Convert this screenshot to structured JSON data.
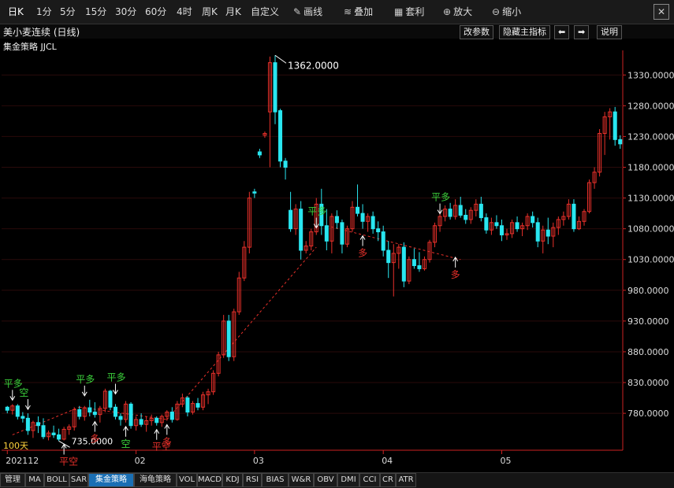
{
  "toolbar": {
    "periods": [
      "日K",
      "1分",
      "5分",
      "15分",
      "30分",
      "60分",
      "4时",
      "周K",
      "月K",
      "自定义"
    ],
    "active": "日K",
    "tools": [
      {
        "icon": "pencil-icon",
        "glyph": "✎",
        "label": "画线"
      },
      {
        "icon": "layers-icon",
        "glyph": "≋",
        "label": "叠加"
      },
      {
        "icon": "arbitrage-icon",
        "glyph": "▦",
        "label": "套利"
      },
      {
        "icon": "zoom-in-icon",
        "glyph": "⊕",
        "label": "放大"
      },
      {
        "icon": "zoom-out-icon",
        "glyph": "⊖",
        "label": "缩小"
      }
    ],
    "close_glyph": "✕"
  },
  "chart_header": {
    "title": "美小麦连续 (日线)",
    "strategy": "集金策略 JJCL",
    "buttons": {
      "modify_params": "改参数",
      "hide_main": "隐藏主指标",
      "prev": "⬅",
      "next": "➡",
      "help": "说明"
    }
  },
  "bottom_tabs": [
    "管理",
    "MA",
    "BOLL",
    "SAR",
    "集金策略",
    "海龟策略",
    "VOL",
    "MACD",
    "KDJ",
    "RSI",
    "BIAS",
    "W&R",
    "OBV",
    "DMI",
    "CCI",
    "CR",
    "ATR"
  ],
  "bottom_active": "集金策略",
  "colors": {
    "up": "#e8302a",
    "down": "#29e6f0",
    "axis": "#cc2222",
    "grid": "#2a0a0a",
    "buy": "#e8302a",
    "sell": "#3cd23c"
  },
  "chart_data": {
    "type": "candlestick",
    "y_ticks": [
      780,
      830,
      880,
      930,
      980,
      1030,
      1080,
      1130,
      1180,
      1230,
      1280,
      1330
    ],
    "ylim": [
      720,
      1370
    ],
    "x_labels": [
      {
        "i": 0,
        "text": "202112"
      },
      {
        "i": 25,
        "text": "02"
      },
      {
        "i": 48,
        "text": "03"
      },
      {
        "i": 73,
        "text": "04"
      },
      {
        "i": 96,
        "text": "05"
      }
    ],
    "count_label": "100天",
    "high_label": {
      "i": 52,
      "text": "1362.0000"
    },
    "low_label": {
      "i": 10,
      "text": "735.0000"
    },
    "candles": [
      [
        790,
        792,
        780,
        785
      ],
      [
        785,
        795,
        778,
        792
      ],
      [
        792,
        795,
        770,
        775
      ],
      [
        775,
        782,
        765,
        772
      ],
      [
        772,
        780,
        745,
        752
      ],
      [
        752,
        768,
        740,
        765
      ],
      [
        765,
        775,
        748,
        760
      ],
      [
        760,
        772,
        738,
        742
      ],
      [
        742,
        752,
        736,
        748
      ],
      [
        748,
        760,
        740,
        745
      ],
      [
        745,
        755,
        735,
        738
      ],
      [
        738,
        758,
        736,
        754
      ],
      [
        754,
        762,
        745,
        758
      ],
      [
        758,
        790,
        752,
        786
      ],
      [
        786,
        792,
        770,
        775
      ],
      [
        775,
        792,
        768,
        789
      ],
      [
        789,
        802,
        775,
        782
      ],
      [
        782,
        798,
        773,
        778
      ],
      [
        778,
        792,
        765,
        788
      ],
      [
        788,
        820,
        782,
        816
      ],
      [
        816,
        818,
        785,
        790
      ],
      [
        790,
        795,
        770,
        775
      ],
      [
        775,
        780,
        760,
        770
      ],
      [
        770,
        800,
        765,
        795
      ],
      [
        795,
        798,
        755,
        760
      ],
      [
        760,
        775,
        752,
        770
      ],
      [
        770,
        780,
        758,
        762
      ],
      [
        762,
        775,
        750,
        768
      ],
      [
        768,
        778,
        760,
        772
      ],
      [
        772,
        775,
        760,
        765
      ],
      [
        765,
        778,
        758,
        775
      ],
      [
        775,
        785,
        768,
        782
      ],
      [
        782,
        790,
        765,
        770
      ],
      [
        770,
        800,
        768,
        795
      ],
      [
        795,
        812,
        790,
        805
      ],
      [
        805,
        808,
        775,
        782
      ],
      [
        782,
        800,
        778,
        796
      ],
      [
        796,
        805,
        785,
        790
      ],
      [
        790,
        815,
        785,
        810
      ],
      [
        810,
        820,
        795,
        815
      ],
      [
        815,
        850,
        810,
        845
      ],
      [
        845,
        880,
        840,
        875
      ],
      [
        875,
        940,
        870,
        930
      ],
      [
        930,
        940,
        865,
        872
      ],
      [
        872,
        950,
        865,
        945
      ],
      [
        945,
        1010,
        940,
        1000
      ],
      [
        1000,
        1060,
        995,
        1050
      ],
      [
        1050,
        1140,
        1040,
        1130
      ],
      [
        1140,
        1145,
        1130,
        1138
      ],
      [
        1205,
        1210,
        1195,
        1200
      ],
      [
        1232,
        1238,
        1228,
        1235
      ],
      [
        1270,
        1360,
        1180,
        1350
      ],
      [
        1350,
        1362,
        1250,
        1270
      ],
      [
        1272,
        1275,
        1180,
        1190
      ],
      [
        1190,
        1195,
        1160,
        1180
      ],
      [
        1110,
        1140,
        1075,
        1080
      ],
      [
        1080,
        1120,
        1070,
        1112
      ],
      [
        1112,
        1125,
        1030,
        1045
      ],
      [
        1045,
        1060,
        1040,
        1052
      ],
      [
        1052,
        1080,
        1045,
        1075
      ],
      [
        1075,
        1130,
        1070,
        1120
      ],
      [
        1120,
        1145,
        1070,
        1085
      ],
      [
        1085,
        1112,
        1045,
        1060
      ],
      [
        1060,
        1105,
        1040,
        1100
      ],
      [
        1100,
        1110,
        1080,
        1090
      ],
      [
        1090,
        1095,
        1040,
        1055
      ],
      [
        1055,
        1085,
        1050,
        1080
      ],
      [
        1080,
        1125,
        1075,
        1115
      ],
      [
        1115,
        1152,
        1100,
        1105
      ],
      [
        1105,
        1120,
        1080,
        1092
      ],
      [
        1092,
        1105,
        1075,
        1100
      ],
      [
        1100,
        1108,
        1072,
        1080
      ],
      [
        1080,
        1092,
        1060,
        1075
      ],
      [
        1075,
        1085,
        1035,
        1045
      ],
      [
        1045,
        1060,
        1000,
        1025
      ],
      [
        1025,
        1055,
        970,
        1040
      ],
      [
        1040,
        1055,
        1015,
        1050
      ],
      [
        1050,
        1058,
        985,
        995
      ],
      [
        995,
        1035,
        990,
        1030
      ],
      [
        1030,
        1048,
        1015,
        1020
      ],
      [
        1020,
        1042,
        1010,
        1015
      ],
      [
        1015,
        1035,
        1012,
        1030
      ],
      [
        1030,
        1062,
        1025,
        1058
      ],
      [
        1058,
        1090,
        1050,
        1085
      ],
      [
        1085,
        1110,
        1075,
        1100
      ],
      [
        1100,
        1118,
        1092,
        1112
      ],
      [
        1112,
        1122,
        1095,
        1100
      ],
      [
        1100,
        1128,
        1095,
        1118
      ],
      [
        1118,
        1132,
        1098,
        1102
      ],
      [
        1102,
        1112,
        1088,
        1095
      ],
      [
        1095,
        1115,
        1088,
        1110
      ],
      [
        1110,
        1128,
        1100,
        1120
      ],
      [
        1120,
        1132,
        1092,
        1098
      ],
      [
        1098,
        1105,
        1072,
        1078
      ],
      [
        1078,
        1098,
        1070,
        1090
      ],
      [
        1090,
        1102,
        1080,
        1085
      ],
      [
        1085,
        1095,
        1060,
        1070
      ],
      [
        1070,
        1080,
        1062,
        1072
      ],
      [
        1072,
        1095,
        1065,
        1090
      ],
      [
        1090,
        1100,
        1075,
        1080
      ],
      [
        1080,
        1090,
        1068,
        1085
      ],
      [
        1085,
        1105,
        1078,
        1100
      ],
      [
        1100,
        1108,
        1082,
        1090
      ],
      [
        1090,
        1098,
        1050,
        1060
      ],
      [
        1060,
        1085,
        1040,
        1078
      ],
      [
        1078,
        1098,
        1055,
        1068
      ],
      [
        1068,
        1090,
        1050,
        1082
      ],
      [
        1082,
        1100,
        1070,
        1095
      ],
      [
        1095,
        1108,
        1085,
        1100
      ],
      [
        1100,
        1128,
        1095,
        1120
      ],
      [
        1120,
        1128,
        1075,
        1080
      ],
      [
        1080,
        1100,
        1078,
        1092
      ],
      [
        1092,
        1112,
        1085,
        1108
      ],
      [
        1108,
        1160,
        1105,
        1155
      ],
      [
        1155,
        1180,
        1145,
        1172
      ],
      [
        1172,
        1242,
        1165,
        1235
      ],
      [
        1235,
        1270,
        1200,
        1262
      ],
      [
        1262,
        1276,
        1225,
        1270
      ],
      [
        1270,
        1278,
        1215,
        1225
      ],
      [
        1225,
        1232,
        1210,
        1218
      ]
    ],
    "signals": [
      {
        "i": 1,
        "text": "平多",
        "color": "sell",
        "pos": "above",
        "y": 795,
        "arrow": "down"
      },
      {
        "i": 4,
        "text": "空",
        "color": "sell",
        "pos": "above",
        "y": 780,
        "arrow": "down"
      },
      {
        "i": 11,
        "text": "平空",
        "color": "buy",
        "pos": "below",
        "y": 736,
        "arrow": "up"
      },
      {
        "i": 15,
        "text": "平多",
        "color": "sell",
        "pos": "above",
        "y": 802,
        "arrow": "down"
      },
      {
        "i": 17,
        "text": "多",
        "color": "buy",
        "pos": "below",
        "y": 773,
        "arrow": "up"
      },
      {
        "i": 21,
        "text": "平多",
        "color": "sell",
        "pos": "above",
        "y": 805,
        "arrow": "down"
      },
      {
        "i": 23,
        "text": "空",
        "color": "sell",
        "pos": "below",
        "y": 765,
        "arrow": "up"
      },
      {
        "i": 29,
        "text": "平空",
        "color": "buy",
        "pos": "below",
        "y": 760,
        "arrow": "up"
      },
      {
        "i": 31,
        "text": "多",
        "color": "buy",
        "pos": "below",
        "y": 768,
        "arrow": "up"
      },
      {
        "i": 60,
        "text": "平多",
        "color": "sell",
        "pos": "above",
        "y": 1075,
        "arrow": "down"
      },
      {
        "i": 69,
        "text": "多",
        "color": "buy",
        "pos": "below",
        "y": 1075,
        "arrow": "up"
      },
      {
        "i": 84,
        "text": "平多",
        "color": "sell",
        "pos": "above",
        "y": 1098,
        "arrow": "down"
      },
      {
        "i": 87,
        "text": "多",
        "color": "buy",
        "pos": "below",
        "y": 1040,
        "arrow": "up"
      }
    ]
  }
}
